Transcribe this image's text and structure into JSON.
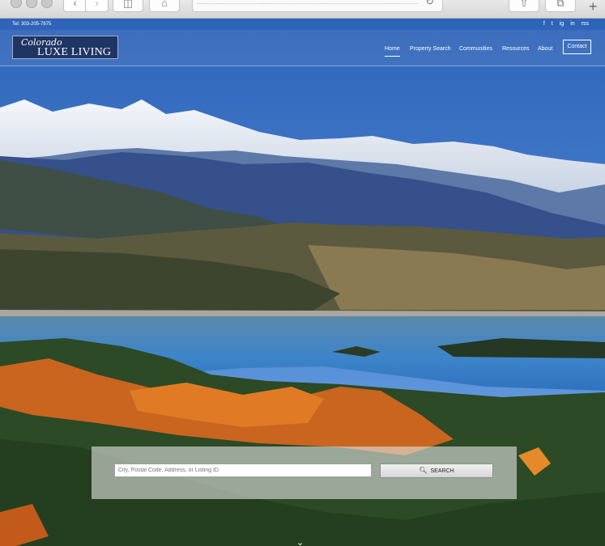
{
  "browser": {
    "back_icon": "back-chevron-icon",
    "forward_icon": "forward-chevron-icon",
    "reload_icon": "reload-icon",
    "new_tab_label": "+"
  },
  "topbar": {
    "phone": "Tel: 303-205-7875",
    "social": [
      "f",
      "t",
      "ig",
      "in",
      "rss"
    ]
  },
  "logo": {
    "line1": "Colorado",
    "line2": "LUXE LIVING"
  },
  "nav": {
    "home": "Home",
    "property_search": "Property Search",
    "communities": "Communities",
    "resources": "Resources",
    "about": "About",
    "contact": "Contact"
  },
  "search": {
    "placeholder": "City, Postal Code, Address, or Listing ID",
    "button_label": "SEARCH"
  },
  "colors": {
    "logo_bg": "#1f3564",
    "sky": "#3a6fb0"
  }
}
